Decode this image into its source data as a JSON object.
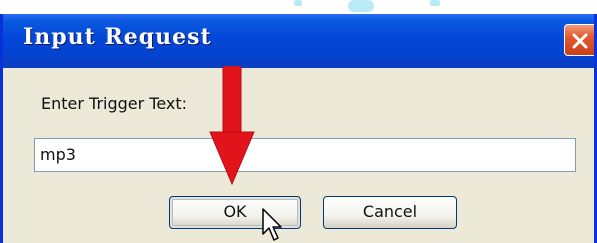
{
  "dialog": {
    "title": "Input Request",
    "prompt_label": "Enter Trigger Text:",
    "input_value": "mp3",
    "ok_label": "OK",
    "cancel_label": "Cancel"
  },
  "icons": {
    "close": "close-icon",
    "arrow": "down-arrow-icon",
    "cursor": "mouse-pointer-icon"
  },
  "colors": {
    "titlebar": "#0446d8",
    "close_button": "#e3582e",
    "window_background": "#ece9d8",
    "annotation_arrow": "#e2141b"
  }
}
